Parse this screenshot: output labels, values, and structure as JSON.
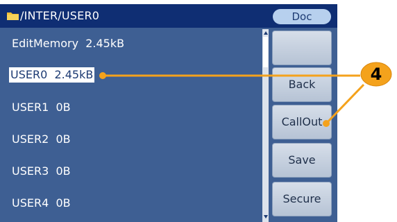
{
  "titlebar": {
    "path": "/INTER/USER0",
    "mode": "Doc",
    "folder_icon": "folder-icon"
  },
  "file_list": [
    {
      "label": "EditMemory  2.45kB",
      "selected": false
    },
    {
      "label": "USER0  2.45kB",
      "selected": true
    },
    {
      "label": "USER1  0B",
      "selected": false
    },
    {
      "label": "USER2  0B",
      "selected": false
    },
    {
      "label": "USER3  0B",
      "selected": false
    },
    {
      "label": "USER4  0B",
      "selected": false
    }
  ],
  "softkeys": [
    "",
    "Back",
    "CallOut",
    "Save",
    "Secure"
  ],
  "callout": {
    "number": "4"
  },
  "colors": {
    "screen": "#3e5f93",
    "titlebar": "#0f2e73",
    "callout": "#f4a21c"
  }
}
